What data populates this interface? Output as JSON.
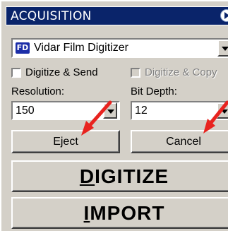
{
  "titlebar": {
    "title": "ACQUISITION"
  },
  "scanner_select": {
    "badge": "FD",
    "value": "Vidar Film Digitizer"
  },
  "checkboxes": {
    "digitize_send": {
      "label": "Digitize & Send",
      "checked": false,
      "enabled": true
    },
    "digitize_copy": {
      "label": "Digitize & Copy",
      "checked": false,
      "enabled": false
    }
  },
  "resolution": {
    "label": "Resolution:",
    "value": "150"
  },
  "bit_depth": {
    "label": "Bit Depth:",
    "value": "12"
  },
  "buttons": {
    "eject": "Eject",
    "cancel": "Cancel",
    "digitize_accel": "D",
    "digitize_rest": "IGITIZE",
    "import_accel": "I",
    "import_rest": "MPORT"
  },
  "annotations": {
    "arrow_color": "#e8231f"
  },
  "colors": {
    "panel": "#d4d0c8",
    "title_bg": "#0a246a"
  }
}
